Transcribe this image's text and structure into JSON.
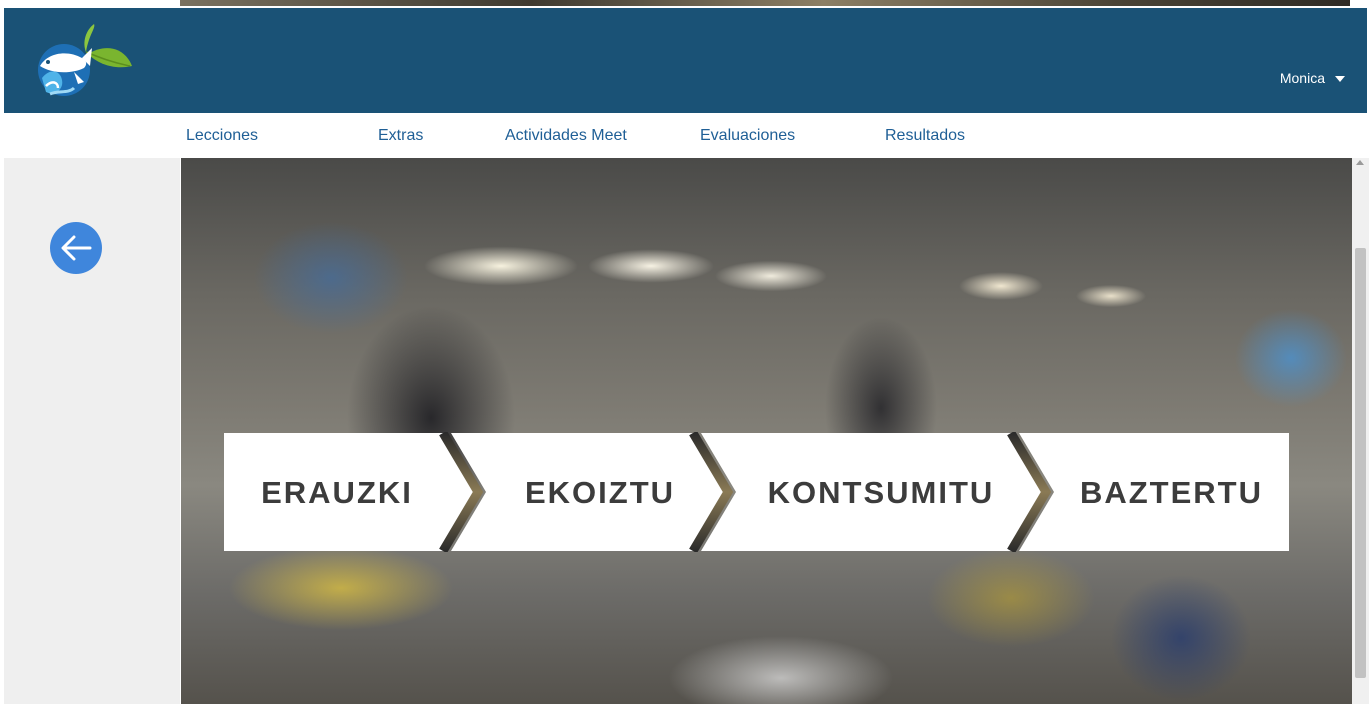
{
  "header": {
    "user_name": "Monica"
  },
  "nav": {
    "items": [
      "Lecciones",
      "Extras",
      "Actividades Meet",
      "Evaluaciones",
      "Resultados"
    ]
  },
  "hero": {
    "steps": [
      "ERAUZKI",
      "EKOIZTU",
      "KONTSUMITU",
      "BAZTERTU"
    ]
  },
  "colors": {
    "header_bg": "#1a5276",
    "nav_link": "#1f5f96",
    "back_button": "#3f86dc",
    "left_panel_bg": "#efefef"
  },
  "icons": {
    "logo": "fish-leaf-wave-logo",
    "back": "arrow-left-icon",
    "user_dropdown": "caret-down-icon"
  }
}
